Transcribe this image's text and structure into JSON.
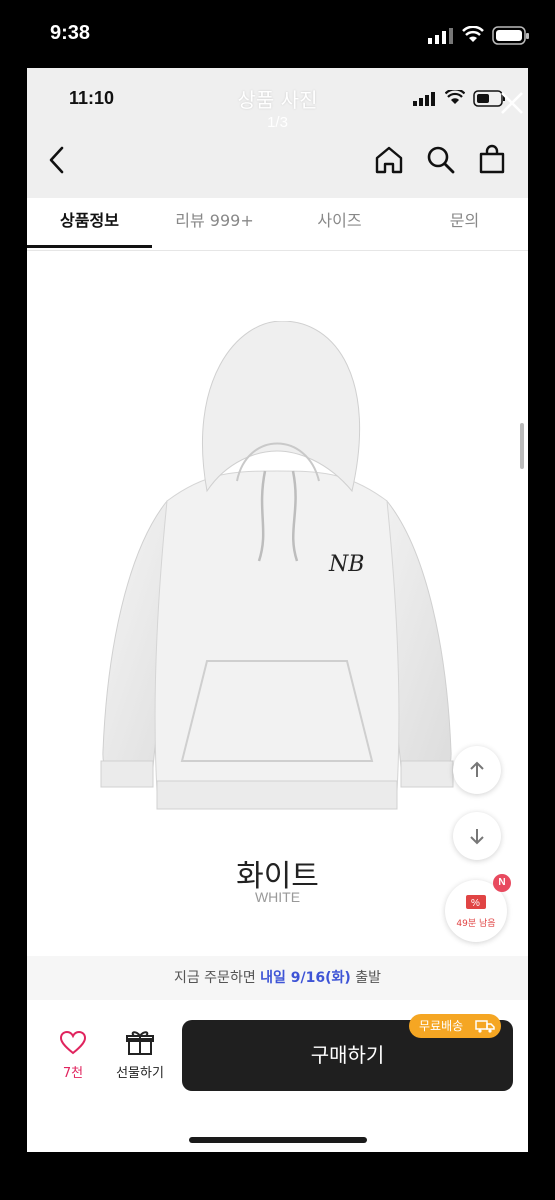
{
  "outer_status": {
    "time": "9:38"
  },
  "inner_status": {
    "time": "11:10"
  },
  "overlay": {
    "title": "상품 사진",
    "counter": "1/3"
  },
  "tabs": [
    {
      "label": "상품정보",
      "active": true
    },
    {
      "label": "리뷰 999+",
      "active": false
    },
    {
      "label": "사이즈",
      "active": false
    },
    {
      "label": "문의",
      "active": false
    }
  ],
  "product": {
    "logo_text": "NB",
    "color_name": "화이트",
    "color_name_en": "WHITE"
  },
  "coupon": {
    "badge": "N",
    "timer": "49분 남음"
  },
  "shipping": {
    "prefix": "지금 주문하면 ",
    "highlight": "내일 9/16(화)",
    "suffix": " 출발"
  },
  "bottom_bar": {
    "like_count": "7천",
    "gift_label": "선물하기",
    "buy_label": "구매하기",
    "free_ship_badge": "무료배송"
  },
  "colors": {
    "accent_blue": "#3e54d6",
    "heart_red": "#e0245e",
    "badge_orange": "#f5a623",
    "buy_dark": "#1f1f1f"
  }
}
